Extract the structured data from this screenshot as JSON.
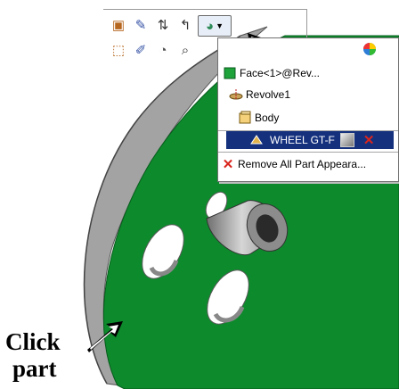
{
  "colors": {
    "part_green": "#0d8a2c",
    "part_edge": "#9a9a9a",
    "selection_blue": "#15317e",
    "remove_red": "#d9241c"
  },
  "toolbar": {
    "row1_icons": [
      "part-properties-icon",
      "edit-sketch-icon",
      "sort-icon",
      "back-icon",
      "appearance-icon",
      "dropdown-arrow-icon"
    ],
    "row2_icons": [
      "select-icon",
      "edit-feature-icon",
      "view-icon",
      "zoom-icon"
    ]
  },
  "menu": {
    "items": [
      {
        "label": "Face<1>@Rev...",
        "icon": "face-icon"
      },
      {
        "label": "Revolve1",
        "icon": "revolve-icon"
      },
      {
        "label": "Body",
        "icon": "body-icon"
      },
      {
        "label": "WHEEL GT-F",
        "icon": "part-icon",
        "selected": true
      },
      {
        "label": "Remove All Part Appeara...",
        "icon": "remove-x-icon"
      }
    ]
  },
  "callout": {
    "line1": "Click",
    "line2": "part"
  }
}
